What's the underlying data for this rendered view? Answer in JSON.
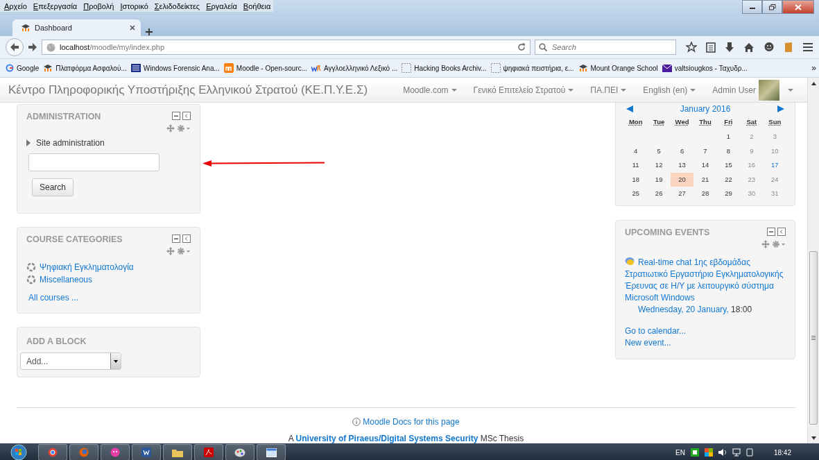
{
  "browser": {
    "menu": [
      "Αρχείο",
      "Επεξεργασία",
      "Προβολή",
      "Ιστορικό",
      "Σελιδοδείκτες",
      "Εργαλεία",
      "Βοήθεια"
    ],
    "tabs": [
      {
        "title": "Dashboard",
        "selected": true
      }
    ],
    "url": {
      "host": "localhost",
      "path": "/moodle/my/index.php"
    },
    "search": {
      "placeholder": "Search"
    },
    "bookmarks": [
      {
        "label": "Google",
        "kind": "g"
      },
      {
        "label": "Πλατφόρμα Ασφαλού...",
        "kind": "hat"
      },
      {
        "label": "Windows Forensic Ana...",
        "kind": "square"
      },
      {
        "label": "Moodle - Open-sourc...",
        "kind": "box"
      },
      {
        "label": "Αγγλοελληνικό Λεξικό ...",
        "kind": "letters"
      },
      {
        "label": "Hacking Books Archiv...",
        "kind": "blank"
      },
      {
        "label": "ψηφιακά πειστήρια, ε...",
        "kind": "blank"
      },
      {
        "label": "Mount Orange School",
        "kind": "hat"
      },
      {
        "label": "valtsiougkos - Ταχυδρ...",
        "kind": "envelope"
      }
    ],
    "bookmarks_more": "»"
  },
  "site": {
    "title": "Κέντρο Πληροφορικής Υποστήριξης Ελληνικού Στρατού (ΚΕ.Π.Υ.Ε.Σ)",
    "menus": [
      "Moodle.com",
      "Γενικό Επιτελείο Στρατού",
      "ΠΑ.ΠΕΙ",
      "English (en)"
    ],
    "user": "Admin User"
  },
  "administration": {
    "title": "ADMINISTRATION",
    "node": {
      "label": "Site administration",
      "expanded": false
    },
    "search_button": "Search"
  },
  "course_categories": {
    "title": "COURSE CATEGORIES",
    "items": [
      "Ψηφιακή Εγκληματολογία",
      "Miscellaneous"
    ],
    "all_courses": "All courses ..."
  },
  "add_block": {
    "title": "ADD A BLOCK",
    "value": "Add..."
  },
  "calendar": {
    "month": "January 2016",
    "weekdays": [
      "Mon",
      "Tue",
      "Wed",
      "Thu",
      "Fri",
      "Sat",
      "Sun"
    ],
    "weeks": [
      [
        {
          "day": "1",
          "today": false,
          "event": false
        },
        {
          "day": "2",
          "today": false,
          "event": false
        },
        {
          "day": "3",
          "today": false,
          "event": false
        }
      ],
      [
        {
          "day": "4",
          "today": false,
          "event": false
        },
        {
          "day": "5",
          "today": false,
          "event": false
        },
        {
          "day": "6",
          "today": false,
          "event": false
        },
        {
          "day": "7",
          "today": false,
          "event": false
        },
        {
          "day": "8",
          "today": false,
          "event": false
        },
        {
          "day": "9",
          "today": false,
          "event": false
        },
        {
          "day": "10",
          "today": false,
          "event": false
        }
      ],
      [
        {
          "day": "11",
          "today": false,
          "event": false
        },
        {
          "day": "12",
          "today": false,
          "event": false
        },
        {
          "day": "13",
          "today": false,
          "event": false
        },
        {
          "day": "14",
          "today": false,
          "event": false
        },
        {
          "day": "15",
          "today": false,
          "event": false
        },
        {
          "day": "16",
          "today": false,
          "event": false
        },
        {
          "day": "17",
          "today": false,
          "event": true
        }
      ],
      [
        {
          "day": "18",
          "today": false,
          "event": false
        },
        {
          "day": "19",
          "today": false,
          "event": false
        },
        {
          "day": "20",
          "today": true,
          "event": false
        },
        {
          "day": "21",
          "today": false,
          "event": false
        },
        {
          "day": "22",
          "today": false,
          "event": false
        },
        {
          "day": "23",
          "today": false,
          "event": false
        },
        {
          "day": "24",
          "today": false,
          "event": false
        }
      ],
      [
        {
          "day": "25",
          "today": false,
          "event": false
        },
        {
          "day": "26",
          "today": false,
          "event": false
        },
        {
          "day": "27",
          "today": false,
          "event": false
        },
        {
          "day": "28",
          "today": false,
          "event": false
        },
        {
          "day": "29",
          "today": false,
          "event": false
        },
        {
          "day": "30",
          "today": false,
          "event": false
        },
        {
          "day": "31",
          "today": false,
          "event": false
        }
      ]
    ]
  },
  "upcoming_events": {
    "title": "UPCOMING EVENTS",
    "events": [
      {
        "name": "Real-time chat 1ης εβδομάδας Στρατιωτικό Εργαστήριο Εγκληματολογικής Έρευνας σε Η/Υ με λειτουργικό σύστημα Microsoft Windows",
        "date": "Wednesday, 20 January,",
        "time": "18:00"
      }
    ],
    "links": [
      "Go to calendar...",
      "New event..."
    ]
  },
  "footer": {
    "docs_link": "Moodle Docs for this page",
    "credit": {
      "prefix": "A",
      "link": "University of Piraeus/Digital Systems Security",
      "suffix": "MSc Thesis"
    }
  },
  "taskbar": {
    "language": "EN",
    "clock": "18:42"
  }
}
